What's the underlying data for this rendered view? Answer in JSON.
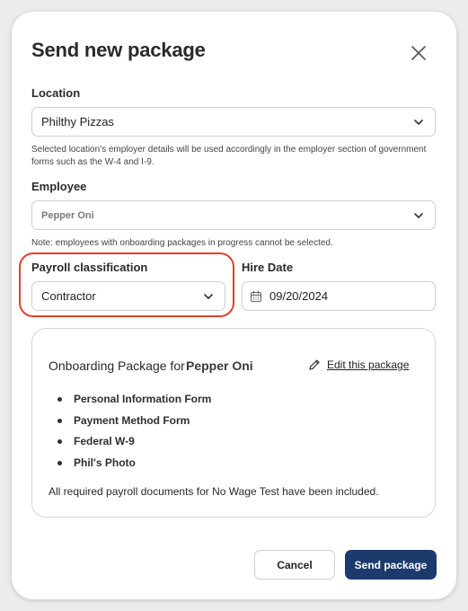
{
  "modal": {
    "title": "Send new package",
    "close_icon": "close-icon"
  },
  "location": {
    "label": "Location",
    "value": "Philthy Pizzas",
    "help": "Selected location's employer details will be used accordingly in the employer section of government forms such as the W-4 and I-9."
  },
  "employee": {
    "label": "Employee",
    "value": "Pepper Oni",
    "help": "Note: employees with onboarding packages in progress cannot be selected."
  },
  "payroll": {
    "label": "Payroll classification",
    "value": "Contractor",
    "highlight_color": "#e0402a"
  },
  "hire_date": {
    "label": "Hire Date",
    "value": "09/20/2024",
    "icon": "calendar-icon"
  },
  "package": {
    "title": "Onboarding Package for",
    "employee_name": "Pepper Oni",
    "edit_label": "Edit this package",
    "edit_icon": "pencil-icon",
    "documents": [
      "Personal Information Form",
      "Payment Method Form",
      "Federal W-9",
      "Phil's Photo"
    ],
    "footer": "All required payroll documents for No Wage Test have been included."
  },
  "actions": {
    "cancel_label": "Cancel",
    "send_label": "Send package",
    "send_color": "#1c3a6b"
  }
}
